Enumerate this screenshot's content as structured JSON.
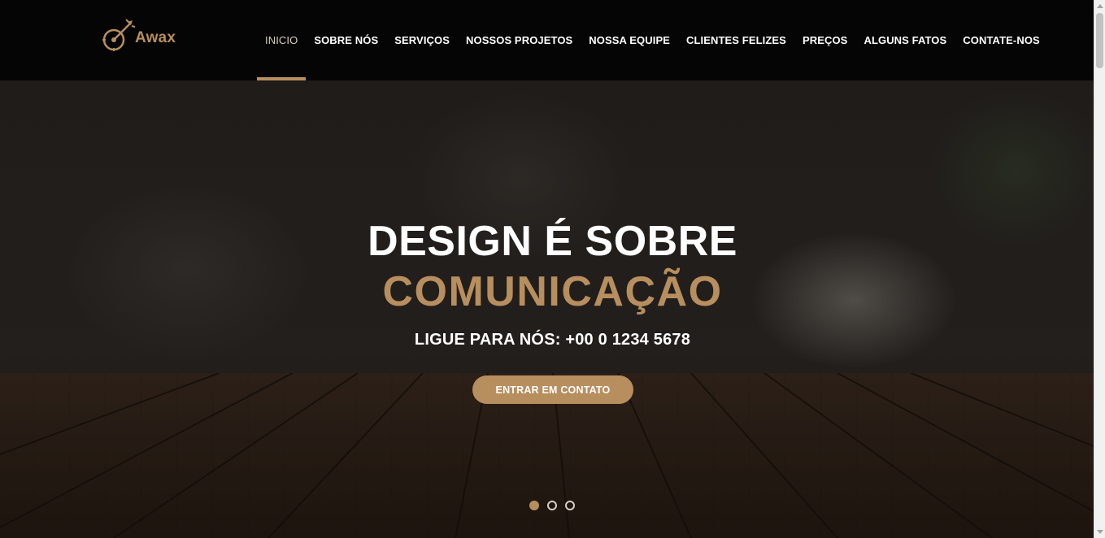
{
  "brand": {
    "name": "Awax",
    "logo_icon": "target-arrow-icon",
    "color": "#b78e5e"
  },
  "nav": {
    "items": [
      {
        "label": "INICIO",
        "active": true
      },
      {
        "label": "SOBRE NÓS"
      },
      {
        "label": "SERVIÇOS"
      },
      {
        "label": "NOSSOS PROJETOS"
      },
      {
        "label": "NOSSA EQUIPE"
      },
      {
        "label": "CLIENTES FELIZES"
      },
      {
        "label": "PREÇOS"
      },
      {
        "label": "ALGUNS FATOS"
      },
      {
        "label": "CONTATE-NOS"
      }
    ]
  },
  "hero": {
    "title_line1": "DESIGN É SOBRE",
    "title_line2": "COMUNICAÇÃO",
    "phone": "LIGUE PARA NÓS: +00 0 1234 5678",
    "cta_label": "ENTRAR EM CONTATO",
    "slides": {
      "count": 3,
      "active_index": 0
    }
  },
  "colors": {
    "accent": "#b78e5e",
    "header_bg": "#050505",
    "text": "#ffffff"
  }
}
